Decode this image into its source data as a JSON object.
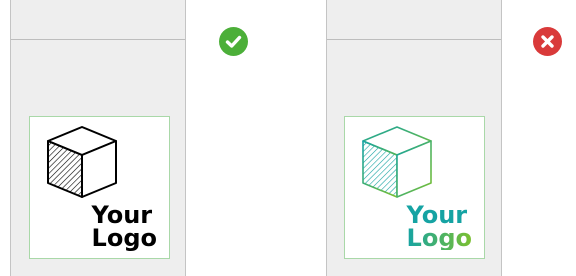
{
  "examples": [
    {
      "id": "good",
      "status": "correct",
      "status_icon": "check-icon",
      "badge_color": "#4caf39",
      "logo_text_lines": [
        "Your",
        "Logo"
      ],
      "logo_color": "#000000"
    },
    {
      "id": "bad",
      "status": "incorrect",
      "status_icon": "close-icon",
      "badge_color": "#d93a3a",
      "logo_text_lines": [
        "Your",
        "Logo"
      ],
      "logo_gradient": [
        "#15a3a3",
        "#7cc02f"
      ]
    }
  ]
}
